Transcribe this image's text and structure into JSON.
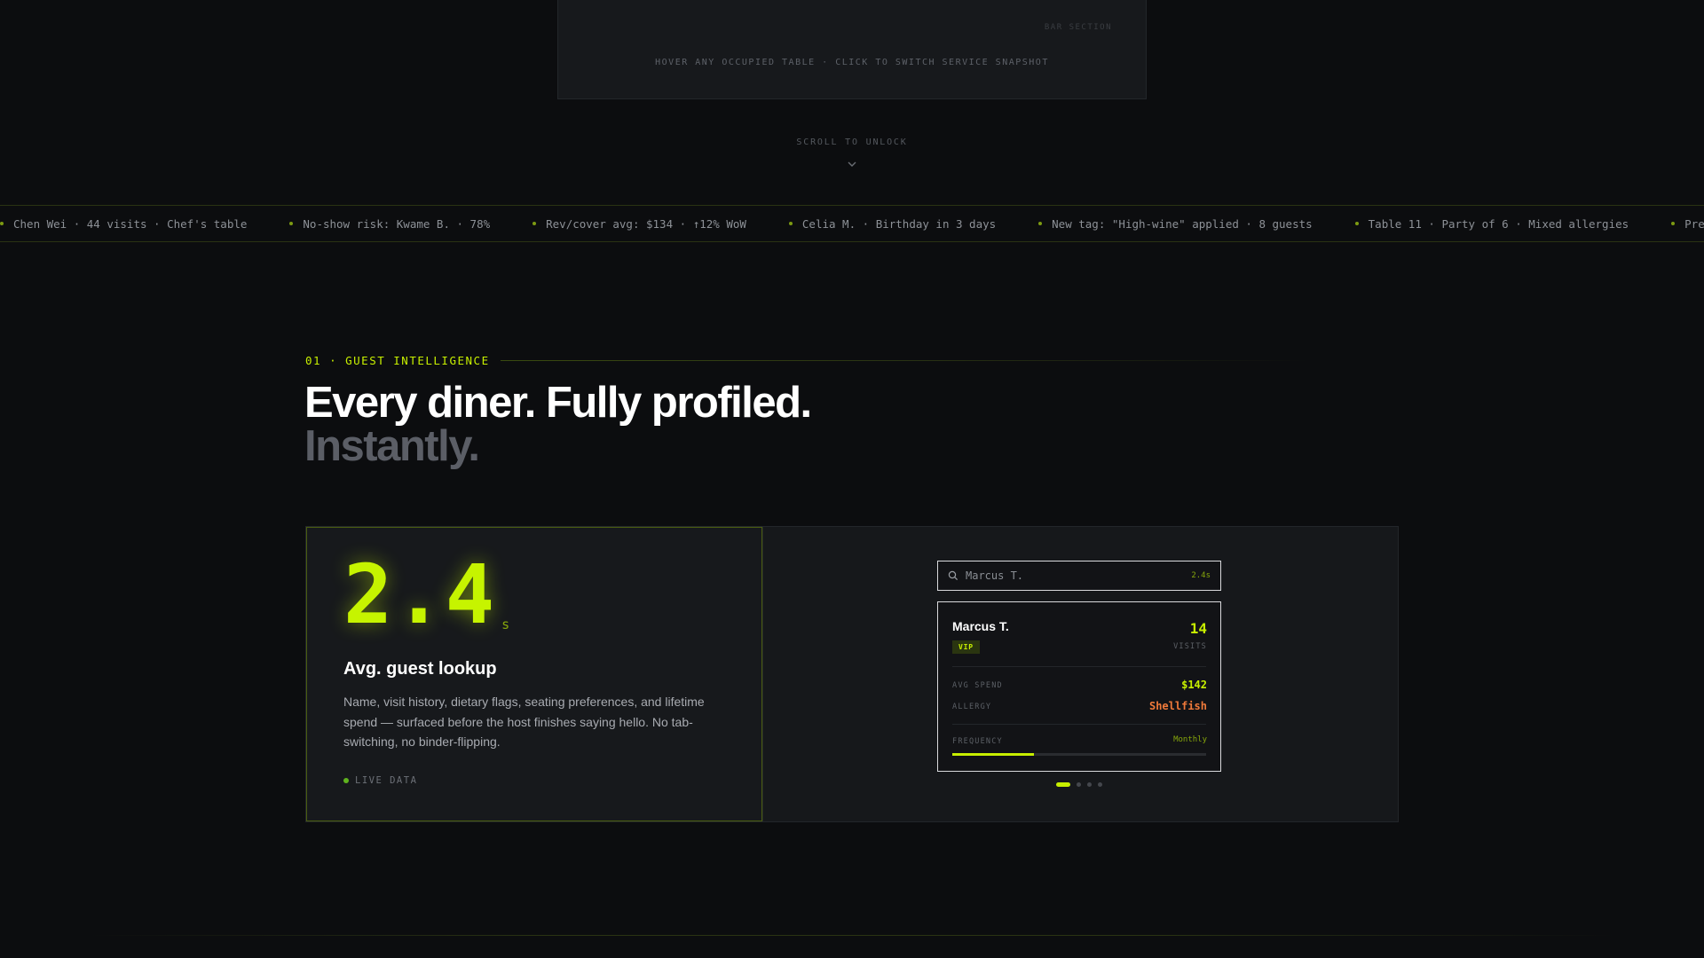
{
  "floor_panel": {
    "section_label": "BAR SECTION",
    "hint": "HOVER ANY OCCUPIED TABLE · CLICK TO SWITCH SERVICE SNAPSHOT"
  },
  "scroll": {
    "label": "SCROLL TO UNLOCK",
    "icon": "chevron-down-icon"
  },
  "ticker": {
    "items": [
      "Chen Wei · 44 visits · Chef's table",
      "No-show risk: Kwame B. · 78%",
      "Rev/cover avg: $134 · ↑12% WoW",
      "Celia M. · Birthday in 3 days",
      "New tag: \"High-wine\" applied · 8 guests",
      "Table 11 · Party of 6 · Mixed allergies",
      "Predictive:"
    ]
  },
  "section": {
    "eyebrow": "01 · GUEST INTELLIGENCE",
    "headline_line1": "Every diner. Fully profiled.",
    "headline_line2": "Instantly."
  },
  "stat": {
    "value": "2.4",
    "unit": "s",
    "title": "Avg. guest lookup",
    "description": "Name, visit history, dietary flags, seating preferences, and lifetime spend — surfaced before the host finishes saying hello. No tab-switching, no binder-flipping.",
    "live_label": "LIVE DATA"
  },
  "demo": {
    "search": {
      "value": "Marcus T.",
      "time": "2.4s",
      "icon": "search-icon"
    },
    "card": {
      "name": "Marcus T.",
      "badge": "VIP",
      "visits_value": "14",
      "visits_label": "VISITS",
      "avg_spend_label": "AVG SPEND",
      "avg_spend_value": "$142",
      "allergy_label": "ALLERGY",
      "allergy_value": "Shellfish",
      "frequency_label": "FREQUENCY",
      "frequency_value": "Monthly",
      "frequency_fill": 0.32
    },
    "pager": {
      "count": 4,
      "active_index": 0
    }
  },
  "colors": {
    "accent": "#c7ef00",
    "allergy": "#f07a3a",
    "spend": "#c7ef00",
    "background": "#0c0d0f",
    "panel": "#16181b"
  }
}
